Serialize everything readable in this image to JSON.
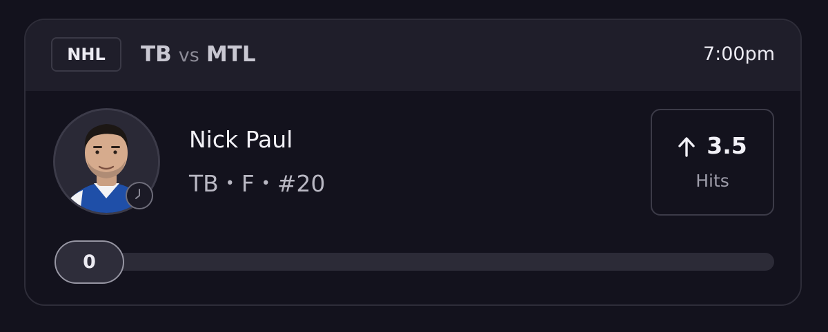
{
  "header": {
    "league": "NHL",
    "home_team": "TB",
    "vs_label": "vs",
    "away_team": "MTL",
    "time": "7:00pm"
  },
  "player": {
    "name": "Nick Paul",
    "team": "TB",
    "position": "F",
    "number": "#20",
    "separator": "•"
  },
  "line": {
    "direction": "up",
    "value": "3.5",
    "stat": "Hits"
  },
  "progress": {
    "current": "0",
    "fraction": 0
  },
  "icons": {
    "avatar": "player-headshot",
    "status": "clock-icon",
    "direction": "arrow-up-icon"
  }
}
